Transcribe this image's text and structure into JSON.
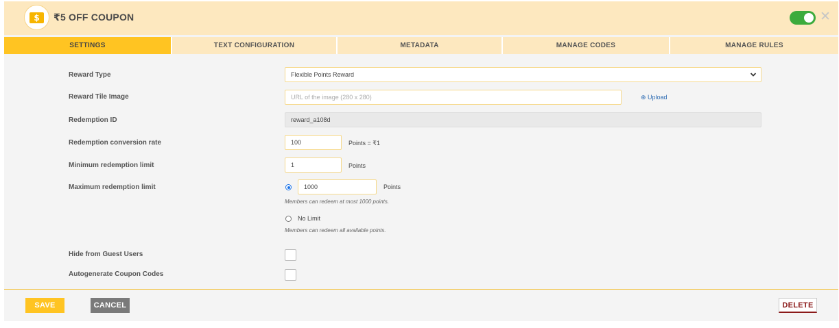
{
  "header": {
    "badge_icon": "coupon-icon",
    "badge_glyph": "$",
    "title": "₹5 OFF COUPON",
    "toggle_on": true,
    "close_glyph": "✕"
  },
  "tabs": [
    {
      "label": "SETTINGS",
      "active": true
    },
    {
      "label": "TEXT CONFIGURATION",
      "active": false
    },
    {
      "label": "METADATA",
      "active": false
    },
    {
      "label": "MANAGE CODES",
      "active": false
    },
    {
      "label": "MANAGE RULES",
      "active": false
    }
  ],
  "form": {
    "reward_type": {
      "label": "Reward Type",
      "value": "Flexible Points Reward"
    },
    "tile_image": {
      "label": "Reward Tile Image",
      "placeholder": "URL of the image (280 x 280)",
      "upload_label": "⊕ Upload"
    },
    "redemption_id": {
      "label": "Redemption ID",
      "value": "reward_a108d"
    },
    "conversion_rate": {
      "label": "Redemption conversion rate",
      "value": "100",
      "unit": "Points = ₹1"
    },
    "min_limit": {
      "label": "Minimum redemption limit",
      "value": "1",
      "unit": "Points"
    },
    "max_limit": {
      "label": "Maximum redemption limit",
      "value": "1000",
      "unit": "Points",
      "hint": "Members can redeem at most 1000 points.",
      "no_limit_label": "No Limit",
      "no_limit_hint": "Members can redeem all available points.",
      "selected": "limited"
    },
    "hide_guest": {
      "label": "Hide from Guest Users",
      "checked": false
    },
    "autogenerate": {
      "label": "Autogenerate Coupon Codes",
      "checked": false
    }
  },
  "footer": {
    "save_label": "SAVE",
    "cancel_label": "CANCEL",
    "delete_label": "DELETE"
  },
  "colors": {
    "accent": "#ffc422",
    "header_bg": "#fde8bf",
    "toggle_on": "#3cab3c",
    "delete_text": "#8b1a1a"
  }
}
